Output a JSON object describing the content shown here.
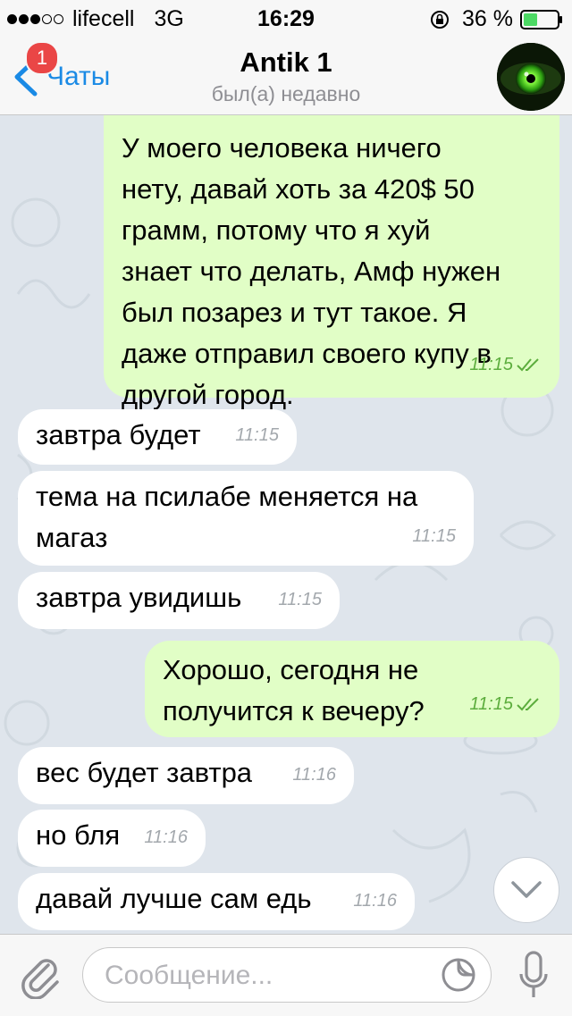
{
  "status_bar": {
    "signal_filled": 3,
    "signal_empty": 2,
    "carrier": "lifecell",
    "network": "3G",
    "time": "16:29",
    "battery_percent": "36 %"
  },
  "nav": {
    "back_label": "Чаты",
    "unread_badge": "1",
    "title": "Antik 1",
    "subtitle": "был(а) недавно"
  },
  "messages": [
    {
      "dir": "out",
      "text": "У моего человека ничего\nнету, давай хоть за 420$ 50\nграмм, потому что я хуй\nзнает что делать, Амф нужен\nбыл позарез и тут такое. Я\nдаже отправил своего купу в\nдругой город.",
      "time": "11:15"
    },
    {
      "dir": "in",
      "text": "завтра будет",
      "time": "11:15"
    },
    {
      "dir": "in",
      "text": "тема на псилабе меняется на\nмагаз",
      "time": "11:15"
    },
    {
      "dir": "in",
      "text": "завтра увидишь",
      "time": "11:15"
    },
    {
      "dir": "out",
      "text": "Хорошо, сегодня не\nполучится к вечеру?",
      "time": "11:15"
    },
    {
      "dir": "in",
      "text": "вес будет завтра",
      "time": "11:16"
    },
    {
      "dir": "in",
      "text": "но бля",
      "time": "11:16"
    },
    {
      "dir": "in",
      "text": "давай лучше сам едь",
      "time": "11:16"
    }
  ],
  "input": {
    "placeholder": "Сообщение..."
  },
  "colors": {
    "accent": "#1a8ae5",
    "outgoing_bubble": "#e1fec6",
    "incoming_bubble": "#ffffff",
    "chat_background": "#dfe5ec",
    "read_check": "#5cad3d",
    "badge": "#ea4646"
  }
}
